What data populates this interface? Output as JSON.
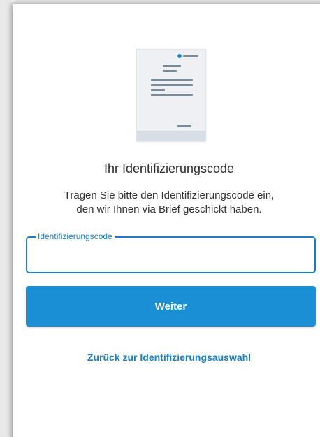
{
  "illustration": {
    "icon": "document-letter-icon",
    "accent_color": "#1a8fd6"
  },
  "heading": {
    "title": "Ihr Identifizierungscode",
    "description_line1": "Tragen Sie bitte den Identifizierungscode ein,",
    "description_line2": "den wir Ihnen via Brief geschickt haben."
  },
  "form": {
    "code_field": {
      "label": "Identifizierungscode",
      "value": "",
      "border_color": "#1b7dc2"
    },
    "submit_label": "Weiter",
    "button_color": "#1a8fd6"
  },
  "back_link": {
    "label": "Zurück zur Identifizierungsauswahl"
  }
}
